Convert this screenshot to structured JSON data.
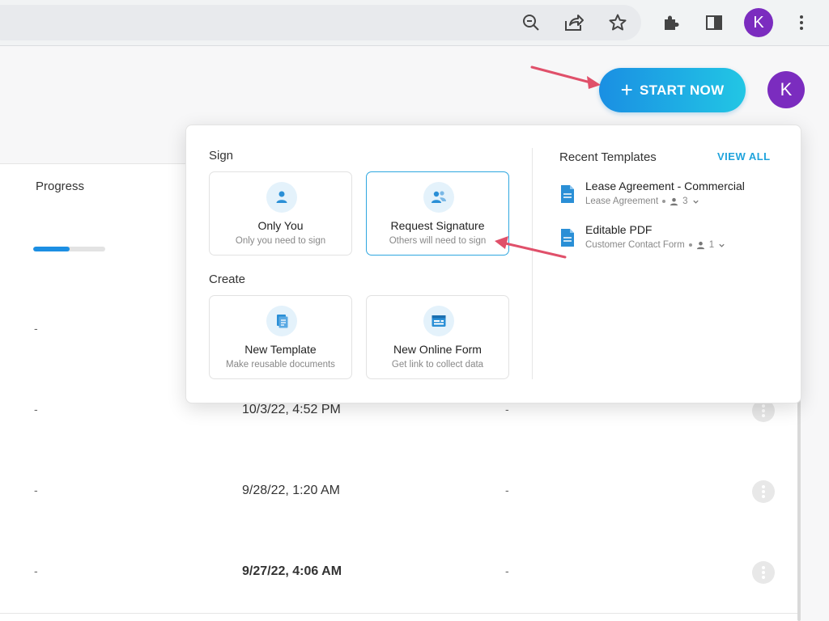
{
  "browser": {
    "profile_initial": "K",
    "icons": [
      "zoom-out-icon",
      "share-icon",
      "star-icon",
      "extensions-icon",
      "side-panel-icon",
      "menu-icon"
    ]
  },
  "header": {
    "start_label": "START NOW",
    "avatar_initial": "K",
    "accent": "#1c8fe3"
  },
  "table": {
    "progress_header": "Progress",
    "rows": [
      {
        "progress_pct": 50,
        "progress_text": "",
        "date": "",
        "col3": ""
      },
      {
        "progress_text": "-",
        "date": "",
        "col3": ""
      },
      {
        "progress_text": "-",
        "date": "10/3/22, 4:52 PM",
        "col3": "-"
      },
      {
        "progress_text": "-",
        "date": "9/28/22, 1:20 AM",
        "col3": "-"
      },
      {
        "progress_text": "-",
        "date": "9/27/22, 4:06 AM",
        "col3": "-"
      }
    ]
  },
  "menu": {
    "sign_title": "Sign",
    "create_title": "Create",
    "cards": {
      "only_you": {
        "title": "Only You",
        "sub": "Only you need to sign"
      },
      "request_signature": {
        "title": "Request Signature",
        "sub": "Others will need to sign"
      },
      "new_template": {
        "title": "New Template",
        "sub": "Make reusable documents"
      },
      "new_online_form": {
        "title": "New Online Form",
        "sub": "Get link to collect data"
      }
    },
    "recent_title": "Recent Templates",
    "view_all": "VIEW ALL",
    "templates": [
      {
        "name": "Lease Agreement - Commercial",
        "meta": "Lease Agreement",
        "signers": "3"
      },
      {
        "name": "Editable PDF",
        "meta": "Customer Contact Form",
        "signers": "1"
      }
    ]
  }
}
